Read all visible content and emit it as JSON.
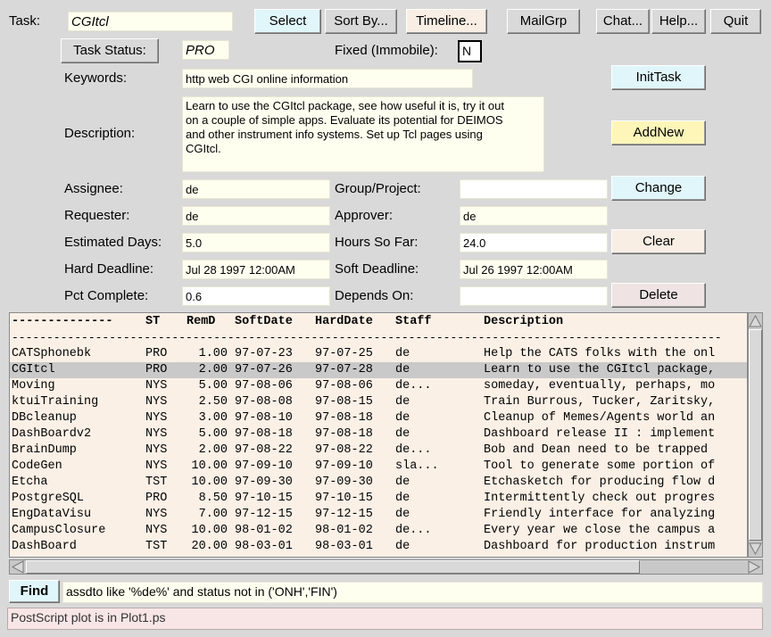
{
  "top": {
    "task_label": "Task:",
    "task_value": "CGItcl",
    "select": "Select",
    "sort_by": "Sort By...",
    "timeline": "Timeline...",
    "mailgrp": "MailGrp",
    "chat": "Chat...",
    "help": "Help...",
    "quit": "Quit"
  },
  "status": {
    "label": "Task Status:",
    "value": "PRO",
    "fixed_label": "Fixed (Immobile):",
    "fixed_value": "N"
  },
  "keywords": {
    "label": "Keywords:",
    "value": "http web CGI online information"
  },
  "description": {
    "label": "Description:",
    "lines": [
      "Learn to use the CGItcl package, see how useful it is, try it out",
      "on a couple of simple apps.  Evaluate its potential for DEIMOS",
      "and other instrument info systems.  Set up Tcl pages using",
      "CGItcl."
    ]
  },
  "actions": {
    "inittask": "InitTask",
    "addnew": "AddNew",
    "change": "Change",
    "clear": "Clear",
    "delete": "Delete"
  },
  "form": {
    "assignee_label": "Assignee:",
    "assignee": "de",
    "group_label": "Group/Project:",
    "group": "",
    "requester_label": "Requester:",
    "requester": "de",
    "approver_label": "Approver:",
    "approver": "de",
    "est_days_label": "Estimated Days:",
    "est_days": "5.0",
    "hours_label": "Hours So Far:",
    "hours": "24.0",
    "hard_label": "Hard Deadline:",
    "hard": "Jul 28 1997 12:00AM",
    "soft_label": "Soft Deadline:",
    "soft": "Jul 26 1997 12:00AM",
    "pct_label": "Pct Complete:",
    "pct": "0.6",
    "depends_label": "Depends On:",
    "depends": ""
  },
  "table": {
    "header": [
      "--------------",
      "ST",
      "RemD",
      "SoftDate",
      "HardDate",
      "Staff",
      "Description"
    ],
    "divider": "------------------------------------------------------------------------------------------------------",
    "selected_index": 1,
    "rows": [
      [
        "CATSphonebk",
        "PRO",
        "1.00",
        "97-07-23",
        "97-07-25",
        "de",
        "Help the CATS folks with the onl"
      ],
      [
        "CGItcl",
        "PRO",
        "2.00",
        "97-07-26",
        "97-07-28",
        "de",
        "Learn to use the CGItcl package,"
      ],
      [
        "Moving",
        "NYS",
        "5.00",
        "97-08-06",
        "97-08-06",
        "de...",
        "someday, eventually, perhaps, mo"
      ],
      [
        "ktuiTraining",
        "NYS",
        "2.50",
        "97-08-08",
        "97-08-15",
        "de",
        "Train Burrous, Tucker, Zaritsky,"
      ],
      [
        "DBcleanup",
        "NYS",
        "3.00",
        "97-08-10",
        "97-08-18",
        "de",
        "Cleanup of Memes/Agents world an"
      ],
      [
        "DashBoardv2",
        "NYS",
        "5.00",
        "97-08-18",
        "97-08-18",
        "de",
        "Dashboard release II : implement"
      ],
      [
        "BrainDump",
        "NYS",
        "2.00",
        "97-08-22",
        "97-08-22",
        "de...",
        "Bob and Dean need to be trapped"
      ],
      [
        "CodeGen",
        "NYS",
        "10.00",
        "97-09-10",
        "97-09-10",
        "sla...",
        "Tool to generate some portion of"
      ],
      [
        "Etcha",
        "TST",
        "10.00",
        "97-09-30",
        "97-09-30",
        "de",
        "Etchasketch for producing flow d"
      ],
      [
        "PostgreSQL",
        "PRO",
        "8.50",
        "97-10-15",
        "97-10-15",
        "de",
        "Intermittently check out progres"
      ],
      [
        "EngDataVisu",
        "NYS",
        "7.00",
        "97-12-15",
        "97-12-15",
        "de",
        "Friendly interface for analyzing"
      ],
      [
        "CampusClosure",
        "NYS",
        "10.00",
        "98-01-02",
        "98-01-02",
        "de...",
        "Every year we close the campus a"
      ],
      [
        "DashBoard",
        "TST",
        "20.00",
        "98-03-01",
        "98-03-01",
        "de",
        "Dashboard for production instrum"
      ]
    ]
  },
  "find": {
    "button": "Find",
    "query": "assdto like '%de%' and status not in ('ONH','FIN')"
  },
  "message": "PostScript plot is in Plot1.ps"
}
